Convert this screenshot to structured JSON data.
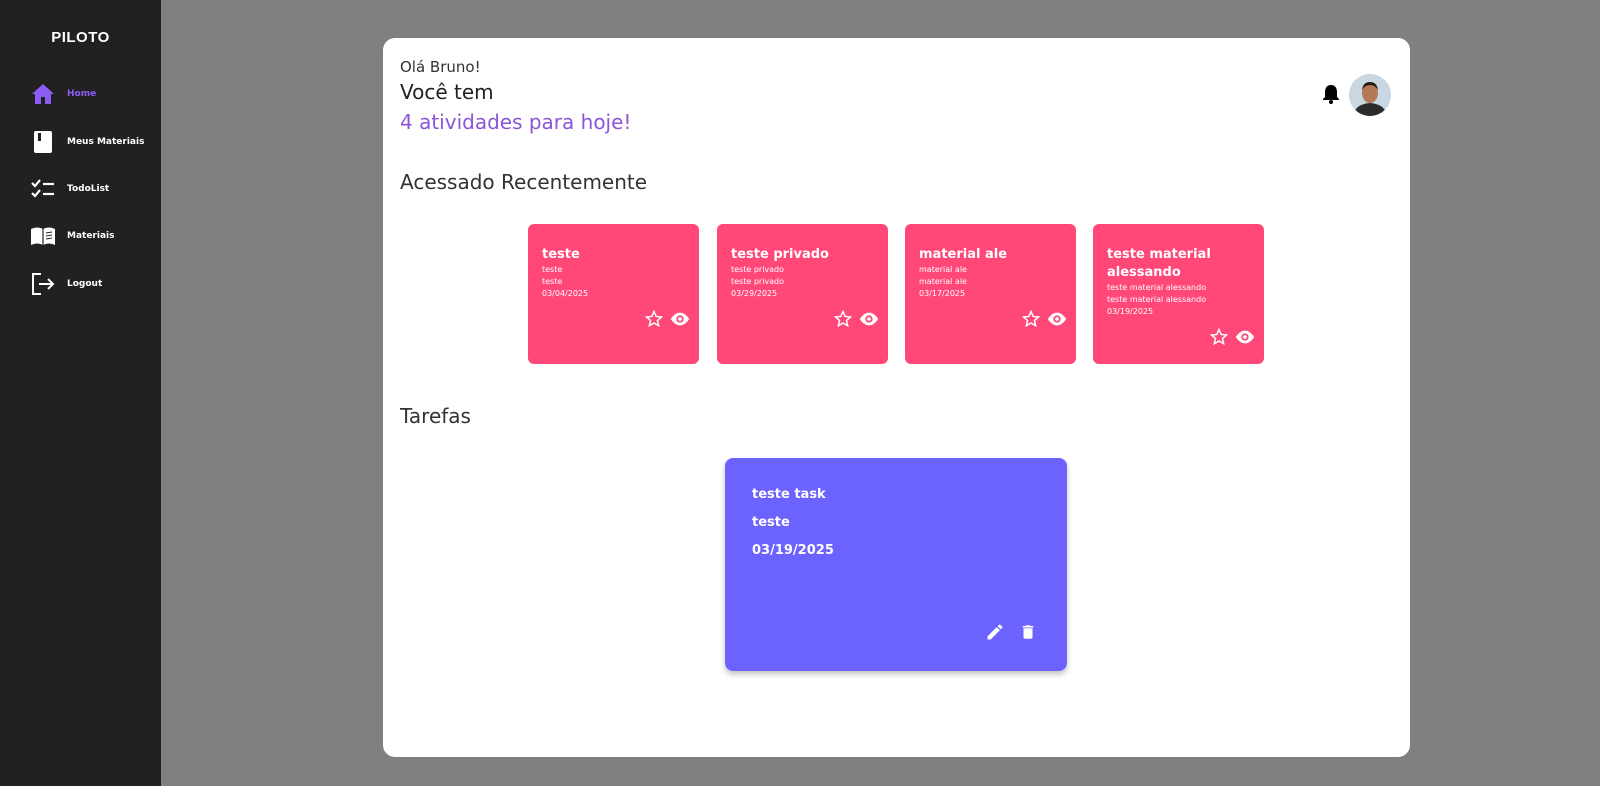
{
  "sidebar": {
    "brand": "PILOTO",
    "items": [
      {
        "label": "Home",
        "icon": "home-icon",
        "active": true
      },
      {
        "label": "Meus Materiais",
        "icon": "notebook-icon",
        "active": false
      },
      {
        "label": "TodoList",
        "icon": "checklist-icon",
        "active": false
      },
      {
        "label": "Materiais",
        "icon": "open-book-icon",
        "active": false
      },
      {
        "label": "Logout",
        "icon": "logout-icon",
        "active": false
      }
    ]
  },
  "header": {
    "greeting": "Olá Bruno!",
    "headline": "Você tem",
    "activities": "4 atividades para hoje!"
  },
  "recent": {
    "title": "Acessado Recentemente",
    "cards": [
      {
        "title": "teste",
        "line1": "teste",
        "line2": "teste",
        "date": "03/04/2025"
      },
      {
        "title": "teste privado",
        "line1": "teste privado",
        "line2": "teste privado",
        "date": "03/29/2025"
      },
      {
        "title": "material ale",
        "line1": "material ale",
        "line2": "material ale",
        "date": "03/17/2025"
      },
      {
        "title": "teste material alessando",
        "line1": "teste material alessando",
        "line2": "teste material alessando",
        "date": "03/19/2025"
      }
    ]
  },
  "tasks": {
    "title": "Tarefas",
    "items": [
      {
        "title": "teste task",
        "description": "teste",
        "date": "03/19/2025"
      }
    ]
  },
  "colors": {
    "sidebar_bg": "#212121",
    "accent": "#8b5cf6",
    "material_card": "#ff4778",
    "task_card": "#6c63ff",
    "page_bg": "#808080"
  }
}
